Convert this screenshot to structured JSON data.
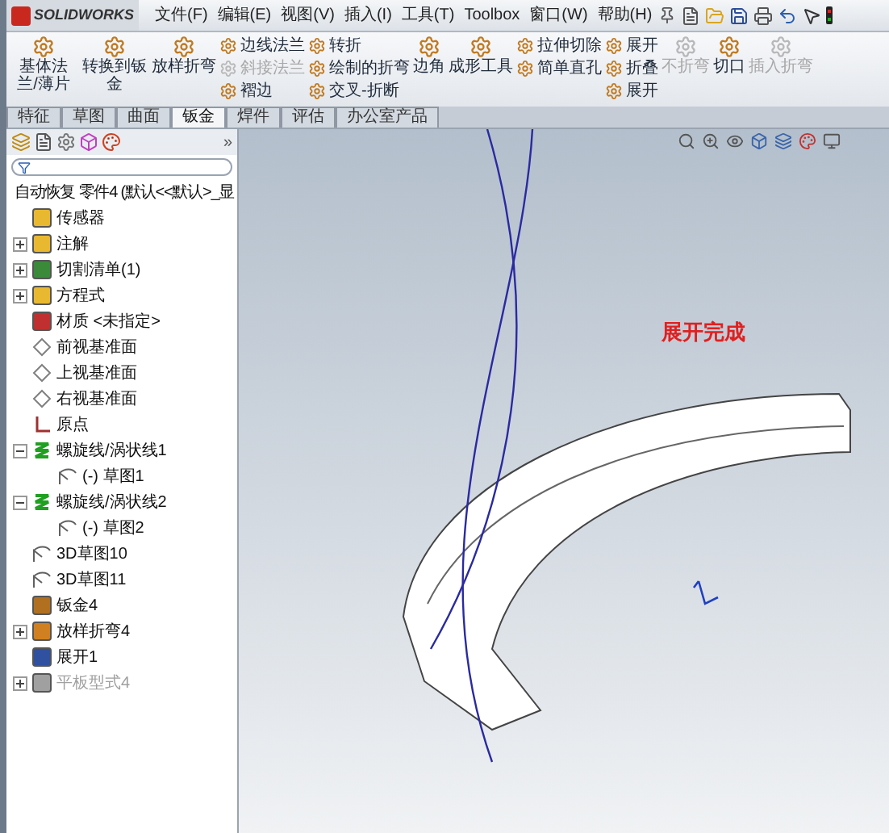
{
  "app": {
    "logo": "SOLIDWORKS"
  },
  "menu": [
    "文件(F)",
    "编辑(E)",
    "视图(V)",
    "插入(I)",
    "工具(T)",
    "Toolbox",
    "窗口(W)",
    "帮助(H)"
  ],
  "ribbon": [
    {
      "kind": "big",
      "items": [
        {
          "label": "基体法兰/薄片",
          "disabled": false
        }
      ]
    },
    {
      "kind": "big",
      "items": [
        {
          "label": "转换到钣金",
          "disabled": false
        }
      ]
    },
    {
      "kind": "big",
      "items": [
        {
          "label": "放样折弯",
          "disabled": false
        }
      ]
    },
    {
      "kind": "small",
      "items": [
        {
          "label": "边线法兰",
          "disabled": false
        },
        {
          "label": "斜接法兰",
          "disabled": true
        },
        {
          "label": "褶边",
          "disabled": false
        }
      ]
    },
    {
      "kind": "small",
      "items": [
        {
          "label": "转折",
          "disabled": false
        },
        {
          "label": "绘制的折弯",
          "disabled": false
        },
        {
          "label": "交叉-折断",
          "disabled": false
        }
      ]
    },
    {
      "kind": "big",
      "items": [
        {
          "label": "边角",
          "disabled": false
        }
      ]
    },
    {
      "kind": "big",
      "items": [
        {
          "label": "成形工具",
          "disabled": false
        }
      ]
    },
    {
      "kind": "small",
      "items": [
        {
          "label": "拉伸切除",
          "disabled": false
        },
        {
          "label": "简单直孔",
          "disabled": false
        }
      ]
    },
    {
      "kind": "small",
      "items": [
        {
          "label": "展开",
          "disabled": false
        },
        {
          "label": "折叠",
          "disabled": false
        },
        {
          "label": "展开",
          "disabled": false
        }
      ]
    },
    {
      "kind": "big",
      "items": [
        {
          "label": "不折弯",
          "disabled": true
        }
      ]
    },
    {
      "kind": "big",
      "items": [
        {
          "label": "切口",
          "disabled": false
        }
      ]
    },
    {
      "kind": "big",
      "items": [
        {
          "label": "插入折弯",
          "disabled": true
        }
      ]
    }
  ],
  "tabs": [
    {
      "label": "特征",
      "selected": false
    },
    {
      "label": "草图",
      "selected": false
    },
    {
      "label": "曲面",
      "selected": false
    },
    {
      "label": "钣金",
      "selected": true
    },
    {
      "label": "焊件",
      "selected": false
    },
    {
      "label": "评估",
      "selected": false
    },
    {
      "label": "办公室产品",
      "selected": false
    }
  ],
  "panel_more": "»",
  "tree": {
    "root": "自动恢复 零件4 (默认<<默认>_显",
    "items": [
      {
        "label": "传感器",
        "kind": "folder",
        "disabled": false
      },
      {
        "label": "注解",
        "kind": "annotation",
        "expanded": false,
        "disabled": false
      },
      {
        "label": "切割清单(1)",
        "kind": "list",
        "expanded": false,
        "disabled": false
      },
      {
        "label": "方程式",
        "kind": "folder",
        "expanded": false,
        "disabled": false
      },
      {
        "label": "材质 <未指定>",
        "kind": "material",
        "disabled": false
      },
      {
        "label": "前视基准面",
        "kind": "plane",
        "disabled": false
      },
      {
        "label": "上视基准面",
        "kind": "plane",
        "disabled": false
      },
      {
        "label": "右视基准面",
        "kind": "plane",
        "disabled": false
      },
      {
        "label": "原点",
        "kind": "origin",
        "disabled": false
      },
      {
        "label": "螺旋线/涡状线1",
        "kind": "helix",
        "expanded": true,
        "disabled": false,
        "children": [
          {
            "label": "(-) 草图1",
            "kind": "sketch",
            "disabled": false
          }
        ]
      },
      {
        "label": "螺旋线/涡状线2",
        "kind": "helix",
        "expanded": true,
        "disabled": false,
        "children": [
          {
            "label": "(-) 草图2",
            "kind": "sketch",
            "disabled": false
          }
        ]
      },
      {
        "label": "3D草图10",
        "kind": "sketch",
        "disabled": false
      },
      {
        "label": "3D草图11",
        "kind": "sketch",
        "disabled": false
      },
      {
        "label": "钣金4",
        "kind": "sheet",
        "disabled": false
      },
      {
        "label": "放样折弯4",
        "kind": "loft",
        "expanded": false,
        "disabled": false
      },
      {
        "label": "展开1",
        "kind": "unfold",
        "disabled": false
      },
      {
        "label": "平板型式4",
        "kind": "flat",
        "expanded": false,
        "disabled": true
      }
    ]
  },
  "viewport": {
    "message": "展开完成"
  }
}
